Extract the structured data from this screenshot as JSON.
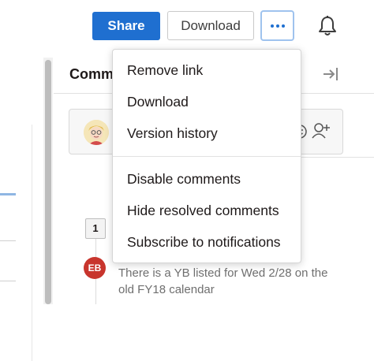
{
  "header": {
    "share_label": "Share",
    "download_label": "Download",
    "more_icon": "more-horizontal-icon",
    "bell_icon": "bell-icon"
  },
  "comments": {
    "tab_label": "Comm",
    "collapse_icon": "collapse-panel-icon",
    "page_badge": "1",
    "author_initials": "EB",
    "comment_text": "There is a YB listed for Wed 2/28 on the old FY18 calendar"
  },
  "menu": {
    "items": [
      {
        "label": "Remove link"
      },
      {
        "label": "Download"
      },
      {
        "label": "Version history"
      },
      {
        "label": "Disable comments"
      },
      {
        "label": "Hide resolved comments"
      },
      {
        "label": "Subscribe to notifications"
      }
    ]
  },
  "colors": {
    "accent": "#1f6fd0",
    "avatar_red": "#c8352d",
    "focus_ring": "#9fc3ee"
  }
}
